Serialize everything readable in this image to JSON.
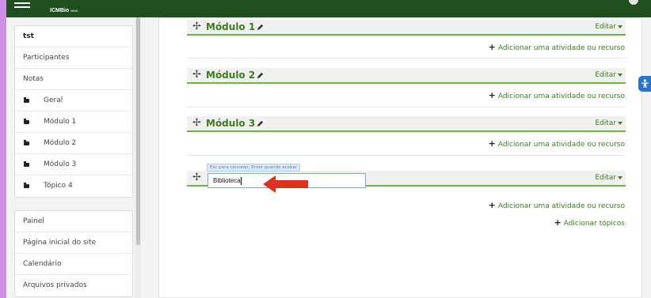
{
  "header": {
    "logo_brand": "ICMBio",
    "logo_sub": "MMA"
  },
  "sidebar": {
    "course_block": [
      {
        "label": "tst",
        "type": "course"
      },
      {
        "label": "Participantes",
        "type": "link"
      },
      {
        "label": "Notas",
        "type": "link"
      },
      {
        "label": "Geral",
        "type": "section"
      },
      {
        "label": "Módulo 1",
        "type": "section"
      },
      {
        "label": "Módulo 2",
        "type": "section"
      },
      {
        "label": "Módulo 3",
        "type": "section"
      },
      {
        "label": "Tópico 4",
        "type": "section"
      }
    ],
    "site_block": [
      {
        "label": "Painel"
      },
      {
        "label": "Página inicial do site"
      },
      {
        "label": "Calendário"
      },
      {
        "label": "Arquivos privados"
      }
    ]
  },
  "sections": [
    {
      "title": "Módulo 1",
      "edit_label": "Editar",
      "add_label": "Adicionar uma atividade ou recurso"
    },
    {
      "title": "Módulo 2",
      "edit_label": "Editar",
      "add_label": "Adicionar uma atividade ou recurso"
    },
    {
      "title": "Módulo 3",
      "edit_label": "Editar",
      "add_label": "Adicionar uma atividade ou recurso"
    }
  ],
  "editing_section": {
    "hint": "Esc para cancelar, Enter quando acabar",
    "input_value": "Biblioteca",
    "edit_label": "Editar",
    "add_label": "Adicionar uma atividade ou recurso"
  },
  "add_topics_label": "Adicionar tópicos",
  "colors": {
    "header_bg": "#1f4e1f",
    "accent_green": "#3d7d1e",
    "section_border": "#6fb249",
    "annotation_arrow": "#e0301e",
    "outer_background": "#cf8fe6",
    "accessibility_button": "#2a73c9"
  },
  "icons": {
    "menu": "hamburger-icon",
    "move": "move-icon",
    "edit_title": "pencil-icon",
    "add": "plus-icon",
    "folder": "folder-icon",
    "accessibility": "accessibility-icon"
  }
}
